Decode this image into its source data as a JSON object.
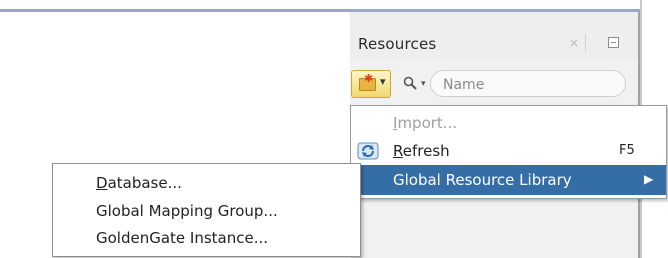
{
  "panel": {
    "title": "Resources",
    "close_glyph": "×",
    "minimize_icon": "minimize-icon"
  },
  "toolbar": {
    "new_button_icon": "new-folder-star-icon",
    "new_caret": "▾",
    "search_icon": "search-icon",
    "search_caret": "▾",
    "search_placeholder": "Name"
  },
  "context_menu": {
    "items": [
      {
        "label": "Import...",
        "mnemonic": "I",
        "rest": "mport...",
        "enabled": false
      },
      {
        "label": "Refresh",
        "mnemonic": "R",
        "rest": "efresh",
        "shortcut": "F5",
        "icon": "refresh-icon",
        "enabled": true
      },
      {
        "label": "Global Resource Library",
        "arrow": "▶",
        "highlighted": true,
        "enabled": true
      }
    ]
  },
  "submenu": {
    "items": [
      {
        "label": "Database...",
        "mnemonic": "D",
        "rest": "atabase..."
      },
      {
        "label": "Global Mapping Group..."
      },
      {
        "label": "GoldenGate Instance..."
      }
    ]
  },
  "colors": {
    "highlight": "#356ea7",
    "disabled_text": "#a0a0a0",
    "window_border": "#9aa9c3"
  }
}
